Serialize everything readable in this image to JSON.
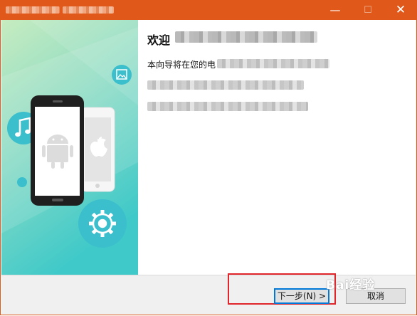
{
  "window": {
    "title": "",
    "minimize_glyph": "—",
    "maximize_glyph": "☐",
    "close_glyph": "✕"
  },
  "welcome": {
    "heading": "欢迎",
    "line1": "本向导将在您的电"
  },
  "buttons": {
    "next": "下一步(N) >",
    "cancel": "取消"
  },
  "watermark": "Bai经验",
  "colors": {
    "titlebar": "#e0591b",
    "highlight_box": "#e0262b",
    "teal": "#3bbfcc",
    "focus": "#0078d7"
  },
  "icons": [
    "music-note-icon",
    "gallery-icon",
    "gear-icon",
    "android-icon",
    "apple-icon"
  ]
}
